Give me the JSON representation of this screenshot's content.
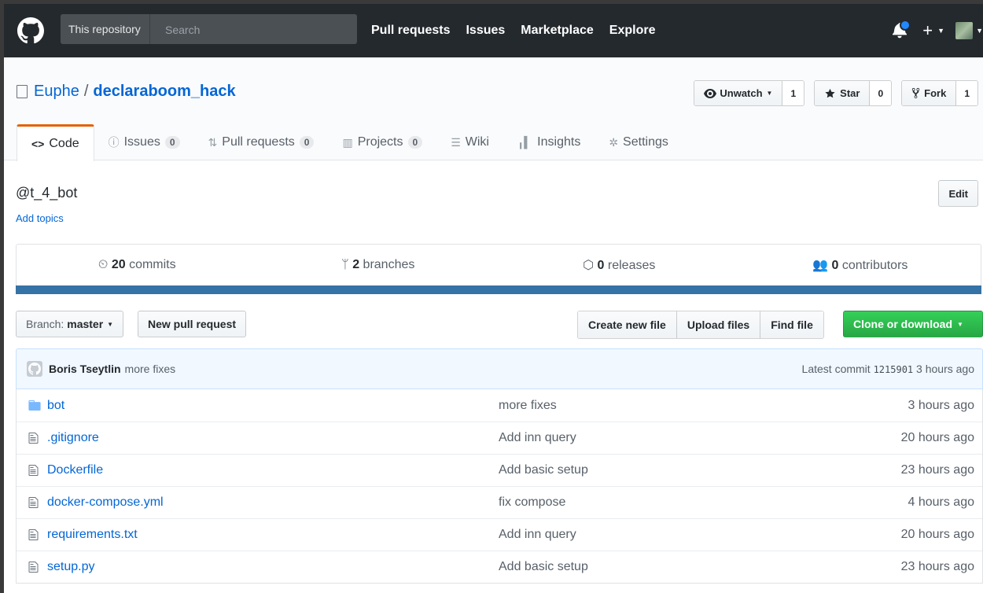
{
  "header": {
    "search_scope": "This repository",
    "search_placeholder": "Search",
    "nav": [
      "Pull requests",
      "Issues",
      "Marketplace",
      "Explore"
    ],
    "plus": "+"
  },
  "repo": {
    "owner": "Euphe",
    "separator": "/",
    "name": "declaraboom_hack",
    "watch_label": "Unwatch",
    "watch_count": "1",
    "star_label": "Star",
    "star_count": "0",
    "fork_label": "Fork",
    "fork_count": "1"
  },
  "tabs": [
    {
      "label": "Code",
      "icon": "code-icon",
      "counter": null
    },
    {
      "label": "Issues",
      "icon": "issue-icon",
      "counter": "0"
    },
    {
      "label": "Pull requests",
      "icon": "pr-icon",
      "counter": "0"
    },
    {
      "label": "Projects",
      "icon": "project-icon",
      "counter": "0"
    },
    {
      "label": "Wiki",
      "icon": "book-icon",
      "counter": null
    },
    {
      "label": "Insights",
      "icon": "graph-icon",
      "counter": null
    },
    {
      "label": "Settings",
      "icon": "gear-icon",
      "counter": null
    }
  ],
  "description": {
    "text": "@t_4_bot",
    "add_topics": "Add topics",
    "edit": "Edit"
  },
  "summary": {
    "commits_count": "20",
    "commits_label": "commits",
    "branches_count": "2",
    "branches_label": "branches",
    "releases_count": "0",
    "releases_label": "releases",
    "contributors_count": "0",
    "contributors_label": "contributors",
    "language_color": "#3572a5"
  },
  "file_nav": {
    "branch_prefix": "Branch:",
    "branch_name": "master",
    "new_pr": "New pull request",
    "create_file": "Create new file",
    "upload_files": "Upload files",
    "find_file": "Find file",
    "clone": "Clone or download"
  },
  "latest_commit": {
    "author": "Boris Tseytlin",
    "message": "more fixes",
    "label": "Latest commit",
    "sha": "1215901",
    "age": "3 hours ago"
  },
  "files": [
    {
      "name": "bot",
      "type": "dir",
      "message": "more fixes",
      "age": "3 hours ago"
    },
    {
      "name": ".gitignore",
      "type": "file",
      "message": "Add inn query",
      "age": "20 hours ago"
    },
    {
      "name": "Dockerfile",
      "type": "file",
      "message": "Add basic setup",
      "age": "23 hours ago"
    },
    {
      "name": "docker-compose.yml",
      "type": "file",
      "message": "fix compose",
      "age": "4 hours ago"
    },
    {
      "name": "requirements.txt",
      "type": "file",
      "message": "Add inn query",
      "age": "20 hours ago"
    },
    {
      "name": "setup.py",
      "type": "file",
      "message": "Add basic setup",
      "age": "23 hours ago"
    }
  ]
}
